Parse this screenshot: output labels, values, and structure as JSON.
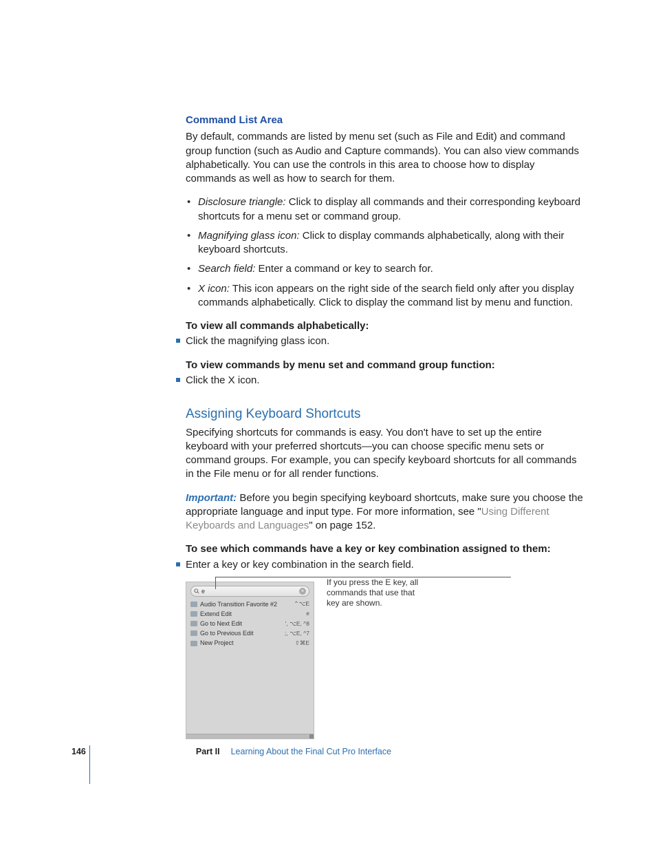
{
  "section1": {
    "title": "Command List Area",
    "intro": "By default, commands are listed by menu set (such as File and Edit) and command group function (such as Audio and Capture commands). You can also view commands alphabetically. You can use the controls in this area to choose how to display commands as well as how to search for them.",
    "bullets": [
      {
        "term": "Disclosure triangle:",
        "text": "  Click to display all commands and their corresponding keyboard shortcuts for a menu set or command group."
      },
      {
        "term": "Magnifying glass icon:",
        "text": "  Click to display commands alphabetically, along with their keyboard shortcuts."
      },
      {
        "term": "Search field:",
        "text": "  Enter a command or key to search for."
      },
      {
        "term": "X icon:",
        "text": "  This icon appears on the right side of the search field only after you display commands alphabetically. Click to display the command list by menu and function."
      }
    ],
    "sub1_head": "To view all commands alphabetically:",
    "sub1_step": "Click the magnifying glass icon.",
    "sub2_head": "To view commands by menu set and command group function:",
    "sub2_step": "Click the X icon."
  },
  "section2": {
    "title": "Assigning Keyboard Shortcuts",
    "intro": "Specifying shortcuts for commands is easy. You don't have to set up the entire keyboard with your preferred shortcuts—you can choose specific menu sets or command groups. For example, you can specify keyboard shortcuts for all commands in the File menu or for all render functions.",
    "important_label": "Important:",
    "important_text": "  Before you begin specifying keyboard shortcuts, make sure you choose the appropriate language and input type. For more information, see \"",
    "important_link": "Using Different Keyboards and Languages",
    "important_tail": "\" on page 152.",
    "sub_head": "To see which commands have a key or key combination assigned to them:",
    "sub_step": "Enter a key or key combination in the search field."
  },
  "figure": {
    "callout": "If you press the E key, all commands that use that key are shown.",
    "search_value": "e",
    "rows": [
      {
        "label": "Audio Transition Favorite #2",
        "keys": "⌃⌥E"
      },
      {
        "label": "Extend Edit",
        "keys": "e"
      },
      {
        "label": "Go to Next Edit",
        "keys": "', ⌥E, ^8"
      },
      {
        "label": "Go to Previous Edit",
        "keys": ";, ⌥E, ^7"
      },
      {
        "label": "New Project",
        "keys": "⇧⌘E"
      }
    ]
  },
  "footer": {
    "page": "146",
    "part": "Part II",
    "title": "Learning About the Final Cut Pro Interface"
  }
}
